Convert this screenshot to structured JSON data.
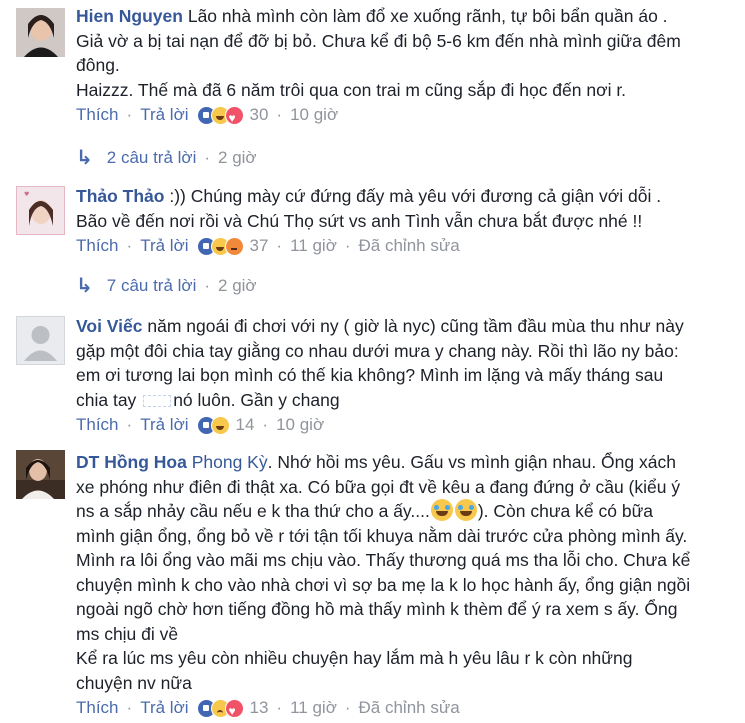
{
  "comments": [
    {
      "author": "Hien Nguyen",
      "lines": [
        "Lão nhà mình còn làm đổ xe xuống rãnh, tự bôi bẩn quần áo .",
        "Giả vờ a bị tai nạn để đỡ bị bỏ. Chưa kể đi bộ 5-6 km đến nhà mình giữa đêm",
        "đông.",
        "Haizzz. Thế mà đã 6 năm trôi qua con trai m cũng sắp đi học đến nơi r."
      ],
      "like_label": "Thích",
      "reply_label": "Trả lời",
      "reaction_count": "30",
      "time": "10 giờ",
      "replies": {
        "label": "2 câu trả lời",
        "time": "2 giờ"
      }
    },
    {
      "author": "Thảo Thảo",
      "lines": [
        ":)) Chúng mày cứ đứng đấy mà yêu với đương cả giận với dỗi .",
        "Bão về đến nơi rồi và Chú Thọ sứt vs anh Tình vẫn chưa bắt được nhé !!"
      ],
      "like_label": "Thích",
      "reply_label": "Trả lời",
      "reaction_count": "37",
      "time": "11 giờ",
      "edited": "Đã chỉnh sửa",
      "replies": {
        "label": "7 câu trả lời",
        "time": "2 giờ"
      }
    },
    {
      "author": "Voi Viếc",
      "lines": [
        "năm ngoái đi chơi với ny ( giờ là nyc) cũng tầm đầu mùa thu như này",
        "gặp một đôi chia tay giằng co nhau dưới mưa y chang này. Rồi thì lão ny bảo:",
        "em ơi tương lai bọn mình có thế kia không? Mình im lặng và mấy tháng sau",
        "nó luôn. Gần y chang"
      ],
      "line4_prefix": "chia tay",
      "like_label": "Thích",
      "reply_label": "Trả lời",
      "reaction_count": "14",
      "time": "10 giờ"
    },
    {
      "author": "DT Hồng Hoa",
      "tag": "Phong Kỳ",
      "lines": [
        ". Nhớ hồi ms yêu. Gấu vs mình giận nhau. Ổng xách",
        "xe phóng như điên đi thật xa. Có bữa gọi đt về kêu a đang đứng ở cầu (kiểu ý",
        "ns a sắp nhảy cầu nếu e k tha thứ cho a ấy....",
        "). Còn chưa kể có bữa",
        "mình giận ổng, ổng bỏ về r tới tận tối khuya nằm dài trước cửa phòng mình ấy.",
        "Mình ra lôi ổng vào mãi ms chịu vào. Thấy thương quá ms tha lỗi cho. Chưa kể",
        "chuyện mình k cho vào nhà chơi vì sợ ba mẹ la k lo học hành ấy, ổng giận ngồi",
        "ngoài ngõ chờ hơn tiếng đồng hồ mà thấy mình k thèm để ý ra xem s ấy. Ổng",
        "ms chịu đi về",
        "Kể ra lúc ms yêu còn nhiều chuyện hay lắm mà h yêu lâu r k còn những",
        "chuyện nv nữa"
      ],
      "like_label": "Thích",
      "reply_label": "Trả lời",
      "reaction_count": "13",
      "time": "11 giờ",
      "edited": "Đã chỉnh sửa"
    }
  ]
}
